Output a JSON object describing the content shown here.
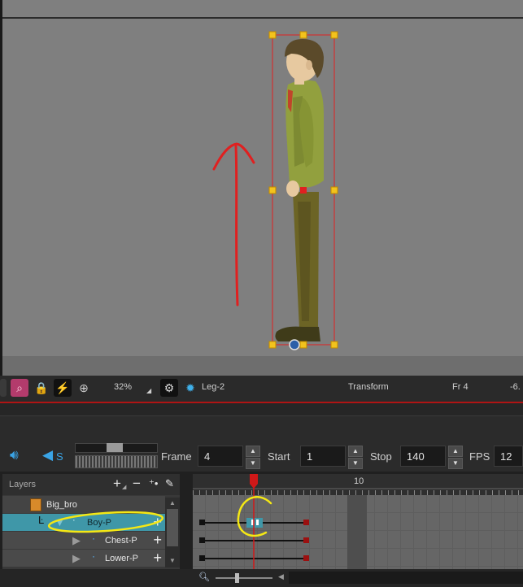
{
  "camera_toolbar": {
    "zoom": "32%",
    "current_element": "Leg-2",
    "mode": "Transform",
    "frame_indicator": "Fr 4",
    "coordinate": "-6."
  },
  "playback": {
    "frame_label": "Frame",
    "frame_value": "4",
    "start_label": "Start",
    "start_value": "1",
    "stop_label": "Stop",
    "stop_value": "140",
    "fps_label": "FPS",
    "fps_value": "12",
    "sound_label": "S"
  },
  "layers": {
    "header": "Layers",
    "items": [
      {
        "name": "Big_bro"
      },
      {
        "name": "Boy-P"
      },
      {
        "name": "Chest-P"
      },
      {
        "name": "Lower-P"
      }
    ]
  },
  "timeline": {
    "ruler_mark": "10",
    "current_frame": 4
  },
  "colors": {
    "selection_red": "#e02020",
    "annotation_yellow": "#f5e814",
    "layer_selected": "#3f97a8"
  }
}
